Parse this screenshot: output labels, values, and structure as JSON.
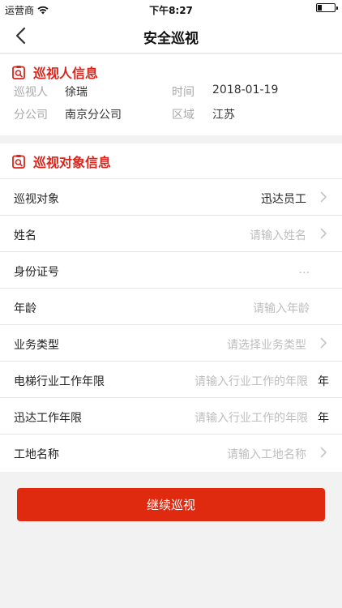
{
  "status_bar": {
    "carrier": "运营商",
    "time": "下午8:27",
    "battery_level": 0.25
  },
  "nav": {
    "title": "安全巡视",
    "back_icon": "chevron-left-icon"
  },
  "inspector_section": {
    "title": "巡视人信息",
    "icon": "clipboard-search-icon",
    "rows": [
      {
        "label": "巡视人",
        "value": "徐瑞"
      },
      {
        "label": "时间",
        "value": "2018-01-19"
      },
      {
        "label": "分公司",
        "value": "南京分公司"
      },
      {
        "label": "区域",
        "value": "江苏"
      }
    ]
  },
  "target_section": {
    "title": "巡视对象信息",
    "icon": "clipboard-search-icon",
    "rows": [
      {
        "label": "巡视对象",
        "value": "迅达员工",
        "placeholder": "",
        "unit": ""
      },
      {
        "label": "姓名",
        "value": "",
        "placeholder": "请输入姓名",
        "unit": ""
      },
      {
        "label": "身份证号",
        "value": "",
        "placeholder": "...",
        "unit": ""
      },
      {
        "label": "年龄",
        "value": "",
        "placeholder": "请输入年龄",
        "unit": ""
      },
      {
        "label": "业务类型",
        "value": "",
        "placeholder": "请选择业务类型",
        "unit": ""
      },
      {
        "label": "电梯行业工作年限",
        "value": "",
        "placeholder": "请输入行业工作的年限",
        "unit": "年"
      },
      {
        "label": "迅达工作年限",
        "value": "",
        "placeholder": "请输入行业工作的年限",
        "unit": "年"
      },
      {
        "label": "工地名称",
        "value": "",
        "placeholder": "请输入工地名称",
        "unit": ""
      }
    ]
  },
  "continue_button": {
    "label": "继续巡视"
  },
  "colors": {
    "accent": "#d9261c",
    "button": "#e02a10",
    "placeholder": "#bdbdbd",
    "muted_label": "#a8a8a8"
  }
}
